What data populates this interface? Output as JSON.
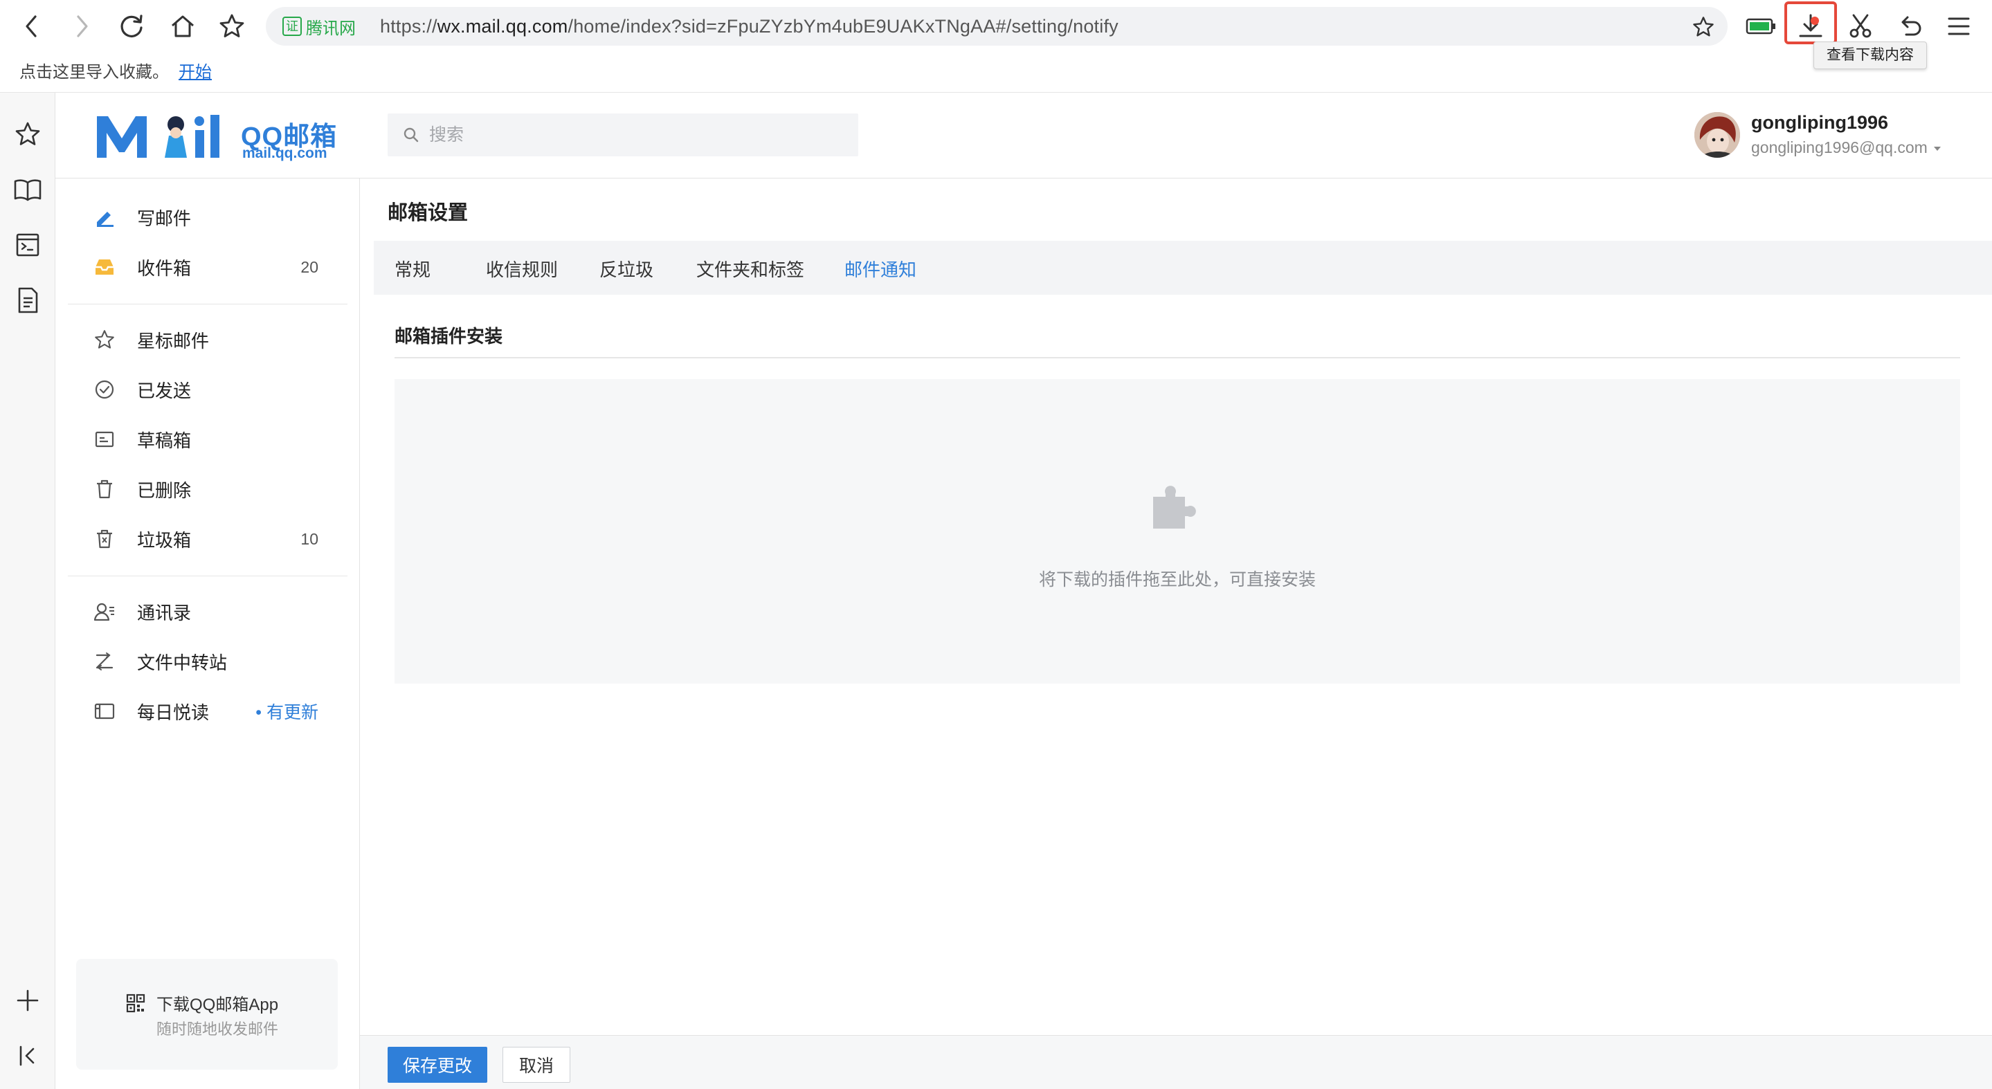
{
  "browser": {
    "cert_label": "证",
    "cert_name": "腾讯网",
    "url_prefix": "https://",
    "url_host": "wx.mail.qq.com",
    "url_path": "/home/index?sid=zFpuZYzbYm4ubE9UAKxTNgAA#/setting/notify",
    "download_tooltip": "查看下载内容",
    "bookmark_message": "点击这里导入收藏。",
    "bookmark_link": "开始"
  },
  "header": {
    "logo_text": "QQ邮箱",
    "logo_sub": "mail.qq.com",
    "search_placeholder": "搜索",
    "user_name": "gongliping1996",
    "user_email": "gongliping1996@qq.com"
  },
  "sidebar": {
    "compose": "写邮件",
    "inbox": "收件箱",
    "inbox_count": "20",
    "starred": "星标邮件",
    "sent": "已发送",
    "drafts": "草稿箱",
    "deleted": "已删除",
    "spam": "垃圾箱",
    "spam_count": "10",
    "contacts": "通讯录",
    "file_transfer": "文件中转站",
    "daily_read": "每日悦读",
    "daily_update": "• 有更新",
    "app_title": "下载QQ邮箱App",
    "app_subtitle": "随时随地收发邮件"
  },
  "main": {
    "page_title": "邮箱设置",
    "tabs": [
      "常规",
      "收信规则",
      "反垃圾",
      "文件夹和标签",
      "邮件通知"
    ],
    "active_tab": "邮件通知",
    "section_title": "邮箱插件安装",
    "dropzone_text": "将下载的插件拖至此处，可直接安装",
    "save_button": "保存更改",
    "cancel_button": "取消"
  },
  "colors": {
    "accent": "#2f7fd9",
    "highlight_box": "#e5483a",
    "secure_green": "#27a84a"
  }
}
